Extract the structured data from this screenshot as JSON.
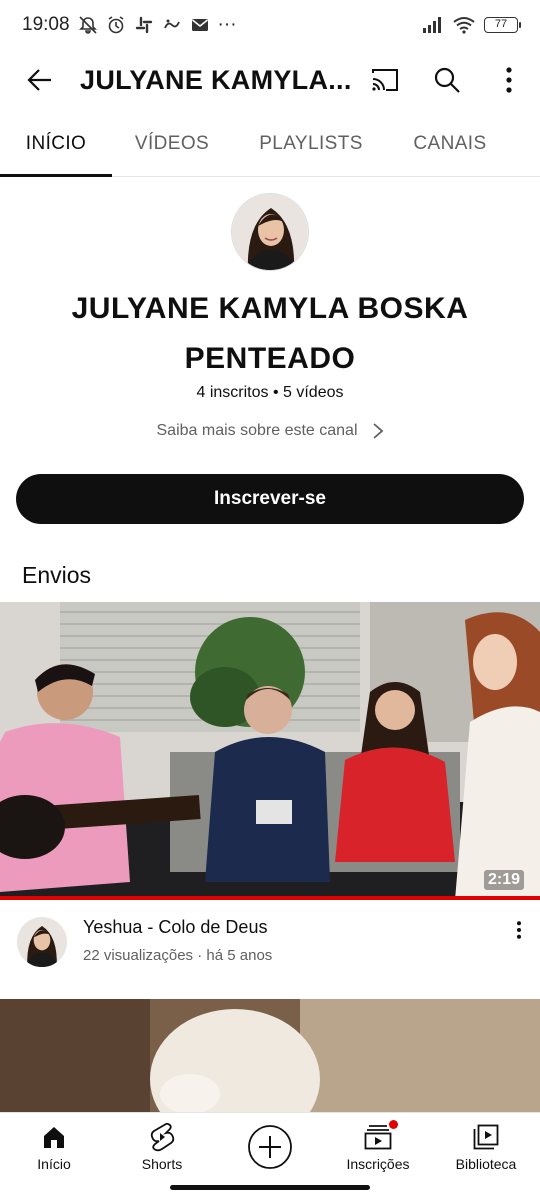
{
  "status_bar": {
    "time": "19:08",
    "dots": "···",
    "battery": "77",
    "icons": [
      "mute-icon",
      "alarm-icon",
      "slack-icon",
      "sticker-icon",
      "mail-icon",
      "signal-icon",
      "wifi-icon",
      "battery-icon"
    ]
  },
  "app_bar": {
    "title": "JULYANE KAMYLA...",
    "icons": [
      "back-arrow-icon",
      "cast-icon",
      "search-icon",
      "more-vert-icon"
    ]
  },
  "tabs": [
    {
      "label": "INÍCIO",
      "active": true
    },
    {
      "label": "VÍDEOS",
      "active": false
    },
    {
      "label": "PLAYLISTS",
      "active": false
    },
    {
      "label": "CANAIS",
      "active": false
    }
  ],
  "channel": {
    "name": "JULYANE KAMYLA BOSKA PENTEADO",
    "stats": "4 inscritos • 5 vídeos",
    "more_link": "Saiba mais sobre este canal",
    "subscribe_label": "Inscrever-se"
  },
  "uploads": {
    "section_title": "Envios",
    "videos": [
      {
        "title": "Yeshua - Colo de Deus",
        "meta": "22 visualizações · há 5 anos",
        "duration": "2:19",
        "watched_fraction": 1.0
      }
    ]
  },
  "bottom_nav": [
    {
      "label": "Início",
      "icon": "home-icon"
    },
    {
      "label": "Shorts",
      "icon": "shorts-icon"
    },
    {
      "label": "",
      "icon": "create-plus-icon"
    },
    {
      "label": "Inscrições",
      "icon": "subscriptions-icon",
      "badge": true
    },
    {
      "label": "Biblioteca",
      "icon": "library-icon"
    }
  ],
  "colors": {
    "accent_red": "#e10000",
    "text_primary": "#0f0f0f",
    "text_secondary": "#606060",
    "button_dark": "#0f0f0f"
  }
}
